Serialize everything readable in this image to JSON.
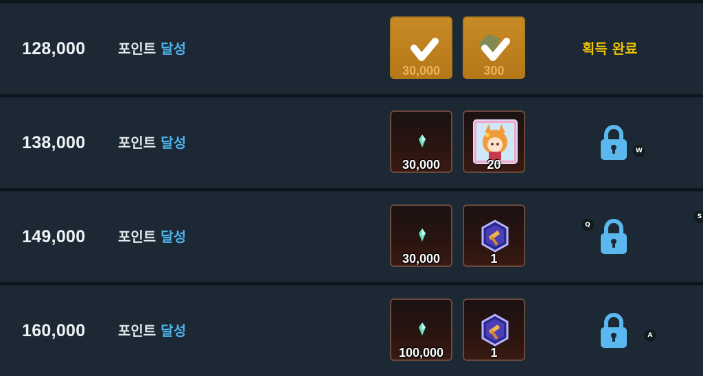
{
  "rows": [
    {
      "points": "128,000",
      "label": "포인트",
      "label_highlight": "달성",
      "rewards": [
        {
          "icon": "crystal-icon",
          "qty": "30,000",
          "claimed": true
        },
        {
          "icon": "gem-box-icon",
          "qty": "300",
          "claimed": true
        }
      ],
      "status": "획득 완료"
    },
    {
      "points": "138,000",
      "label": "포인트",
      "label_highlight": "달성",
      "rewards": [
        {
          "icon": "crystal-icon",
          "qty": "30,000",
          "claimed": false
        },
        {
          "icon": "character-card-icon",
          "qty": "20",
          "claimed": false
        }
      ],
      "status": "locked",
      "hotkey": "W"
    },
    {
      "points": "149,000",
      "label": "포인트",
      "label_highlight": "달성",
      "rewards": [
        {
          "icon": "crystal-icon",
          "qty": "30,000",
          "claimed": false
        },
        {
          "icon": "hammer-gem-icon",
          "qty": "1",
          "claimed": false
        }
      ],
      "status": "locked",
      "hotkey": "Q"
    },
    {
      "points": "160,000",
      "label": "포인트",
      "label_highlight": "달성",
      "rewards": [
        {
          "icon": "crystal-icon",
          "qty": "100,000",
          "claimed": false
        },
        {
          "icon": "hammer-gem-icon",
          "qty": "1",
          "claimed": false
        }
      ],
      "status": "locked",
      "hotkey": "A"
    }
  ],
  "edge_hotkey": "S",
  "colors": {
    "row_bg": "#1c2935",
    "highlight": "#4fb4ee",
    "complete": "#f2c300",
    "lock": "#5ab8ee",
    "claimed_tile": "#c88a26"
  }
}
